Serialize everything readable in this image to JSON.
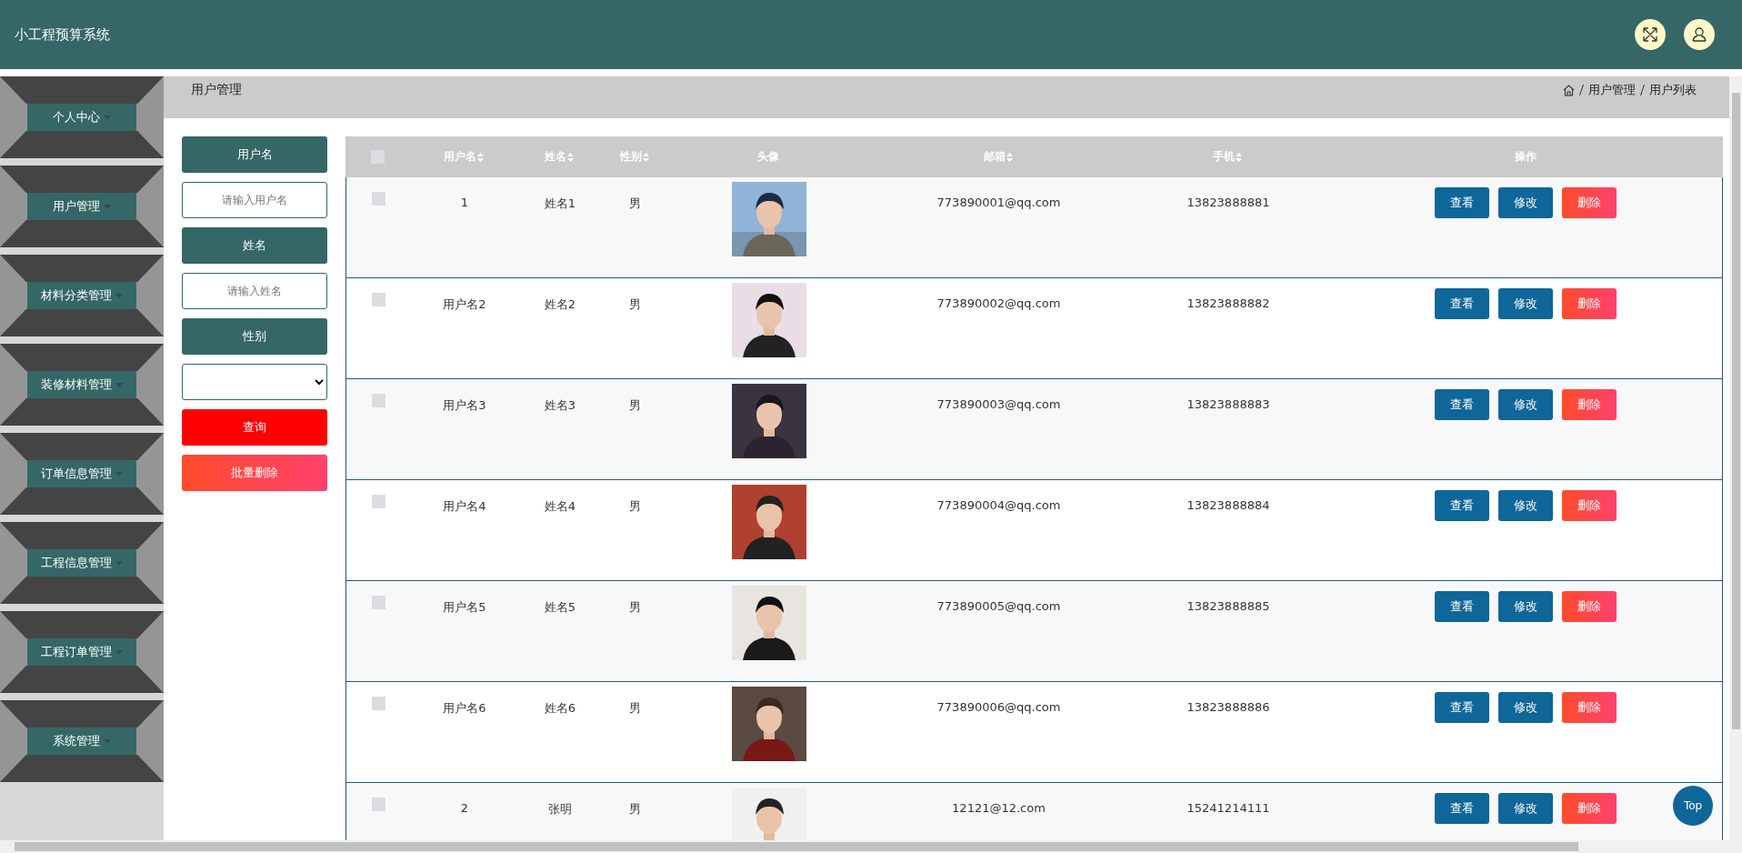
{
  "header": {
    "title": "小工程预算系统"
  },
  "sidebar": {
    "items": [
      {
        "label": "个人中心"
      },
      {
        "label": "用户管理"
      },
      {
        "label": "材料分类管理"
      },
      {
        "label": "装修材料管理"
      },
      {
        "label": "订单信息管理"
      },
      {
        "label": "工程信息管理"
      },
      {
        "label": "工程订单管理"
      },
      {
        "label": "系统管理"
      }
    ]
  },
  "breadcrumb": {
    "title": "用户管理",
    "path": [
      "用户管理",
      "用户列表"
    ]
  },
  "search": {
    "fields": [
      {
        "label": "用户名",
        "kind": "text",
        "placeholder": "请输入用户名"
      },
      {
        "label": "姓名",
        "kind": "text",
        "placeholder": "请输入姓名"
      },
      {
        "label": "性别",
        "kind": "select"
      }
    ],
    "buttons": [
      {
        "label": "查询",
        "kind": "query"
      },
      {
        "label": "批量删除",
        "kind": "batch-delete"
      }
    ]
  },
  "table": {
    "select_all": {
      "checked": false
    },
    "columns": [
      {
        "label": "用户名",
        "sortable": true
      },
      {
        "label": "姓名",
        "sortable": true
      },
      {
        "label": "性别",
        "sortable": true
      },
      {
        "label": "头像",
        "sortable": false
      },
      {
        "label": "邮箱",
        "sortable": true
      },
      {
        "label": "手机",
        "sortable": true
      },
      {
        "label": "操作",
        "sortable": false
      }
    ],
    "rows": [
      {
        "checked": false,
        "username": "1",
        "name": "姓名1",
        "gender": "男",
        "email": "773890001@qq.com",
        "phone": "13823888881",
        "actions": [
          {
            "label": "查看",
            "kind": "view"
          },
          {
            "label": "修改",
            "kind": "edit"
          },
          {
            "label": "删除",
            "kind": "delete"
          }
        ]
      },
      {
        "checked": false,
        "username": "用户名2",
        "name": "姓名2",
        "gender": "男",
        "email": "773890002@qq.com",
        "phone": "13823888882",
        "actions": [
          {
            "label": "查看",
            "kind": "view"
          },
          {
            "label": "修改",
            "kind": "edit"
          },
          {
            "label": "删除",
            "kind": "delete"
          }
        ]
      },
      {
        "checked": false,
        "username": "用户名3",
        "name": "姓名3",
        "gender": "男",
        "email": "773890003@qq.com",
        "phone": "13823888883",
        "actions": [
          {
            "label": "查看",
            "kind": "view"
          },
          {
            "label": "修改",
            "kind": "edit"
          },
          {
            "label": "删除",
            "kind": "delete"
          }
        ]
      },
      {
        "checked": false,
        "username": "用户名4",
        "name": "姓名4",
        "gender": "男",
        "email": "773890004@qq.com",
        "phone": "13823888884",
        "actions": [
          {
            "label": "查看",
            "kind": "view"
          },
          {
            "label": "修改",
            "kind": "edit"
          },
          {
            "label": "删除",
            "kind": "delete"
          }
        ]
      },
      {
        "checked": false,
        "username": "用户名5",
        "name": "姓名5",
        "gender": "男",
        "email": "773890005@qq.com",
        "phone": "13823888885",
        "actions": [
          {
            "label": "查看",
            "kind": "view"
          },
          {
            "label": "修改",
            "kind": "edit"
          },
          {
            "label": "删除",
            "kind": "delete"
          }
        ]
      },
      {
        "checked": false,
        "username": "用户名6",
        "name": "姓名6",
        "gender": "男",
        "email": "773890006@qq.com",
        "phone": "13823888886",
        "actions": [
          {
            "label": "查看",
            "kind": "view"
          },
          {
            "label": "修改",
            "kind": "edit"
          },
          {
            "label": "删除",
            "kind": "delete"
          }
        ]
      },
      {
        "checked": false,
        "username": "2",
        "name": "张明",
        "gender": "男",
        "email": "12121@12.com",
        "phone": "15241214111",
        "actions": [
          {
            "label": "查看",
            "kind": "view"
          },
          {
            "label": "修改",
            "kind": "edit"
          },
          {
            "label": "删除",
            "kind": "delete"
          }
        ]
      }
    ]
  },
  "back_to_top": {
    "label": "Top"
  }
}
